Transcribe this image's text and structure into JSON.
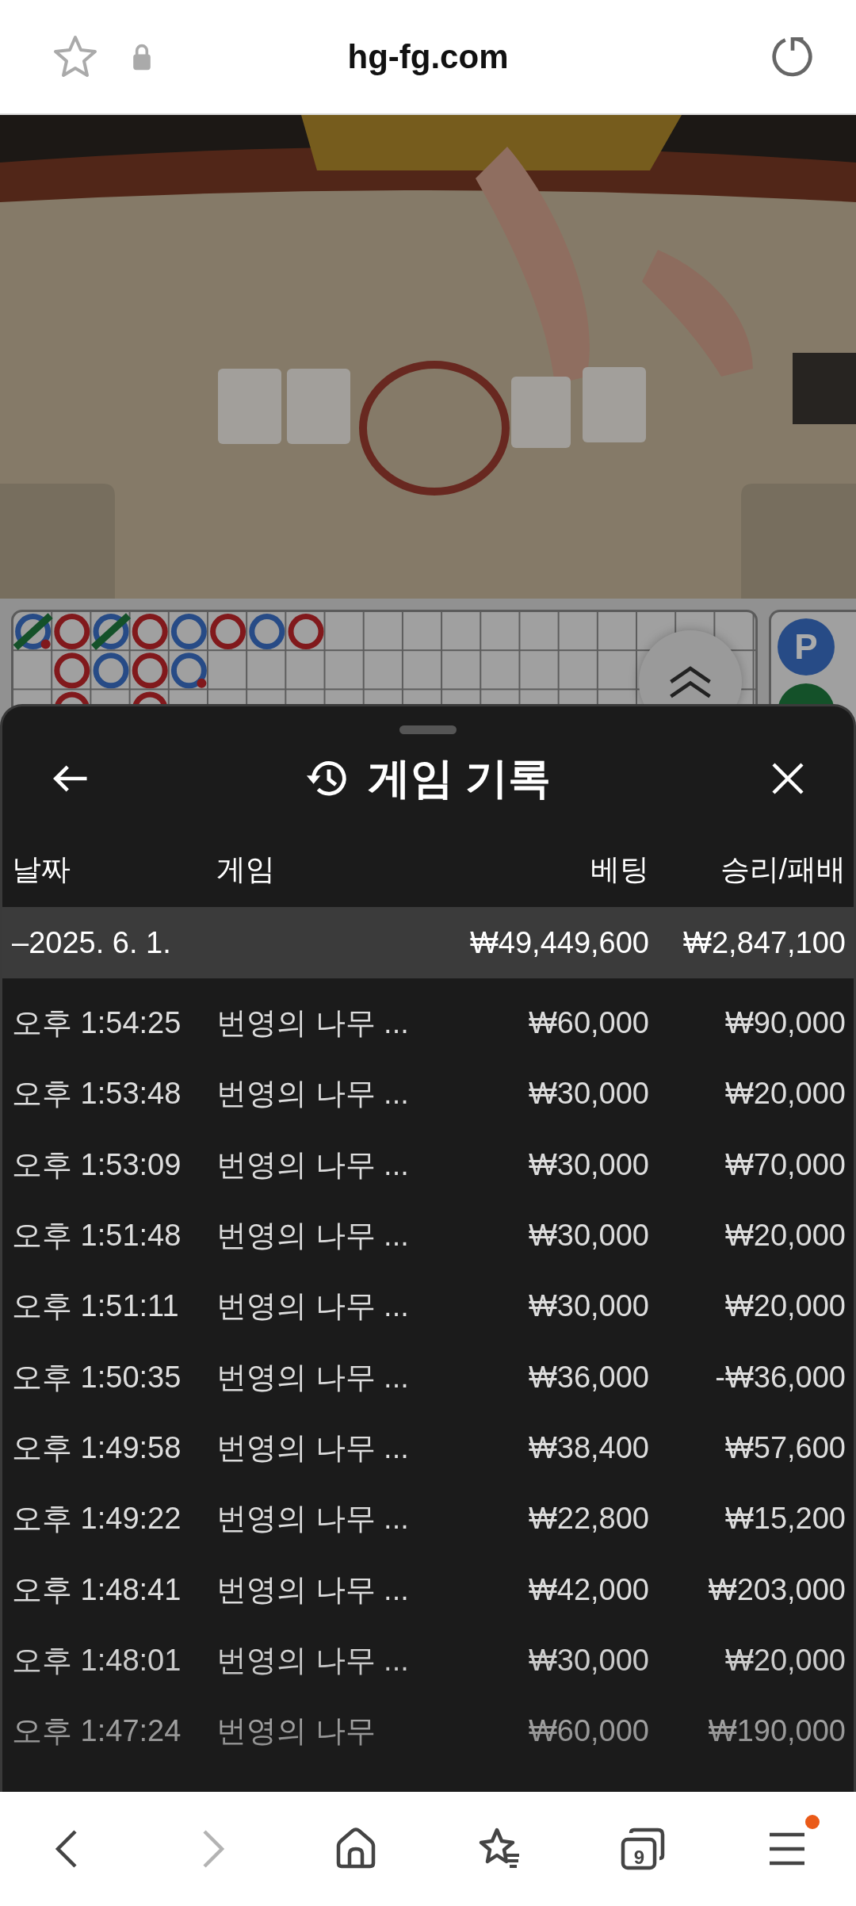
{
  "address_bar": {
    "url": "hg-fg.com"
  },
  "road_panel": {
    "side_buttons": [
      {
        "label": "P",
        "kind": "player"
      },
      {
        "kind": "tie"
      }
    ]
  },
  "sheet": {
    "title": "게임 기록",
    "columns": [
      "날짜",
      "게임",
      "베팅",
      "승리/패배"
    ],
    "summary": {
      "date": "–2025. 6. 1.",
      "bet": "₩49,449,600",
      "result": "₩2,847,100"
    },
    "rows": [
      {
        "time": "오후 1:54:25",
        "game": "번영의 나무 ...",
        "bet": "₩60,000",
        "result": "₩90,000"
      },
      {
        "time": "오후 1:53:48",
        "game": "번영의 나무 ...",
        "bet": "₩30,000",
        "result": "₩20,000"
      },
      {
        "time": "오후 1:53:09",
        "game": "번영의 나무 ...",
        "bet": "₩30,000",
        "result": "₩70,000"
      },
      {
        "time": "오후 1:51:48",
        "game": "번영의 나무 ...",
        "bet": "₩30,000",
        "result": "₩20,000"
      },
      {
        "time": "오후 1:51:11",
        "game": "번영의 나무 ...",
        "bet": "₩30,000",
        "result": "₩20,000"
      },
      {
        "time": "오후 1:50:35",
        "game": "번영의 나무 ...",
        "bet": "₩36,000",
        "result": "-₩36,000"
      },
      {
        "time": "오후 1:49:58",
        "game": "번영의 나무 ...",
        "bet": "₩38,400",
        "result": "₩57,600"
      },
      {
        "time": "오후 1:49:22",
        "game": "번영의 나무 ...",
        "bet": "₩22,800",
        "result": "₩15,200"
      },
      {
        "time": "오후 1:48:41",
        "game": "번영의 나무 ...",
        "bet": "₩42,000",
        "result": "₩203,000"
      },
      {
        "time": "오후 1:48:01",
        "game": "번영의 나무 ...",
        "bet": "₩30,000",
        "result": "₩20,000"
      },
      {
        "time": "오후 1:47:24",
        "game": "번영의 나무",
        "bet": "₩60,000",
        "result": "₩190,000"
      }
    ]
  },
  "bottom_nav": [
    {
      "kind": "back",
      "disabled": false
    },
    {
      "kind": "forward",
      "disabled": true
    },
    {
      "kind": "home",
      "disabled": false
    },
    {
      "kind": "bookmarks",
      "disabled": false
    },
    {
      "kind": "tabs",
      "disabled": false,
      "count": "9"
    },
    {
      "kind": "menu",
      "disabled": false,
      "notification": true
    }
  ]
}
